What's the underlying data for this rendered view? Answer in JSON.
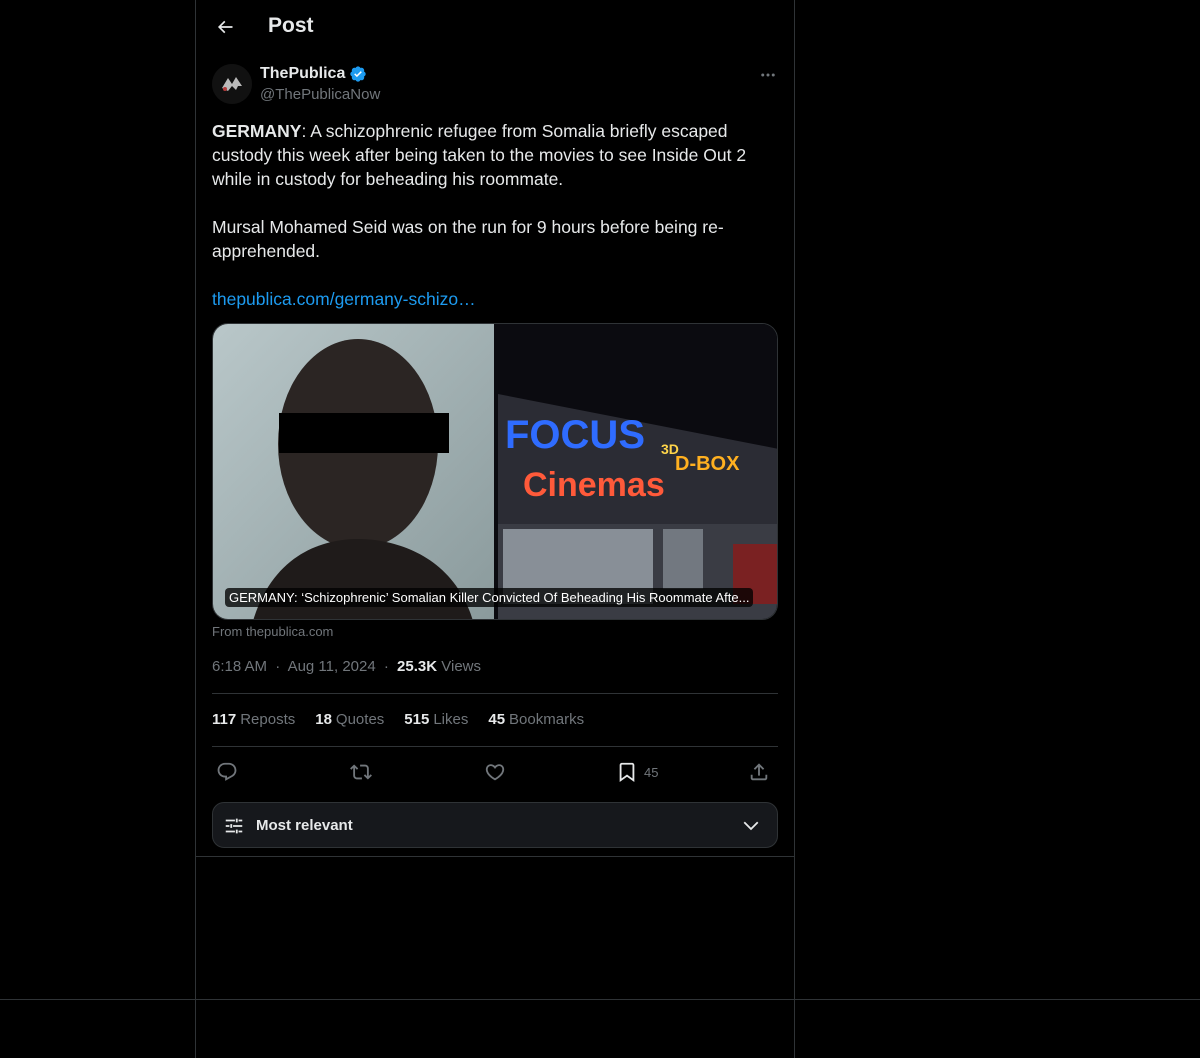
{
  "header": {
    "title": "Post"
  },
  "author": {
    "name": "ThePublica",
    "handle": "@ThePublicaNow",
    "verified_color": "#1d9bf0"
  },
  "tweet": {
    "lead_bold": "GERMANY",
    "paragraph1_rest": ": A schizophrenic refugee from Somalia briefly escaped custody this week after being taken to the movies to see Inside Out 2 while in custody for beheading his roommate.",
    "paragraph2": "Mursal Mohamed Seid was on the run for 9 hours before being re-apprehended.",
    "link_text": "thepublica.com/germany-schizo…"
  },
  "card": {
    "caption": "GERMANY: ‘Schizophrenic’ Somalian Killer Convicted Of Beheading His Roommate Afte...",
    "from": "From thepublica.com",
    "sign_text_1": "FOCUS",
    "sign_text_2": "Cinemas",
    "sign_text_3": "D-BOX",
    "sign_text_4": "3D"
  },
  "meta": {
    "time": "6:18 AM",
    "sep": "·",
    "date": "Aug 11, 2024",
    "views_count": "25.3K",
    "views_label": "Views"
  },
  "stats": [
    {
      "count": "117",
      "label": "Reposts"
    },
    {
      "count": "18",
      "label": "Quotes"
    },
    {
      "count": "515",
      "label": "Likes"
    },
    {
      "count": "45",
      "label": "Bookmarks"
    }
  ],
  "actions": {
    "bookmark_count": "45"
  },
  "sort": {
    "label": "Most relevant"
  },
  "colors": {
    "background": "#000000",
    "border": "#2f3336",
    "text": "#e7e9ea",
    "muted": "#71767b",
    "accent": "#1d9bf0"
  }
}
